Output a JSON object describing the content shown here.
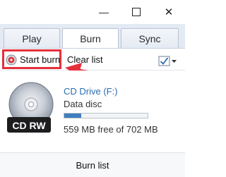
{
  "window": {
    "minimize_glyph": "—",
    "maximize_glyph": "☐",
    "close_glyph": "✕"
  },
  "tabs": [
    {
      "label": "Play",
      "active": false
    },
    {
      "label": "Burn",
      "active": true
    },
    {
      "label": "Sync",
      "active": false
    }
  ],
  "toolbar": {
    "start_burn_label": "Start burn",
    "clear_list_label": "Clear list",
    "options_icon": "checklist-options-icon"
  },
  "drive": {
    "name": "CD Drive (F:)",
    "type": "Data disc",
    "capacity_text": "559 MB free of 702 MB",
    "used_fraction": 0.2,
    "disc_label": "CD RW"
  },
  "footer": {
    "title": "Burn list"
  },
  "colors": {
    "accent": "#2b6cb0",
    "highlight": "#e5303b",
    "tab_bg": "#e3eaf4"
  }
}
